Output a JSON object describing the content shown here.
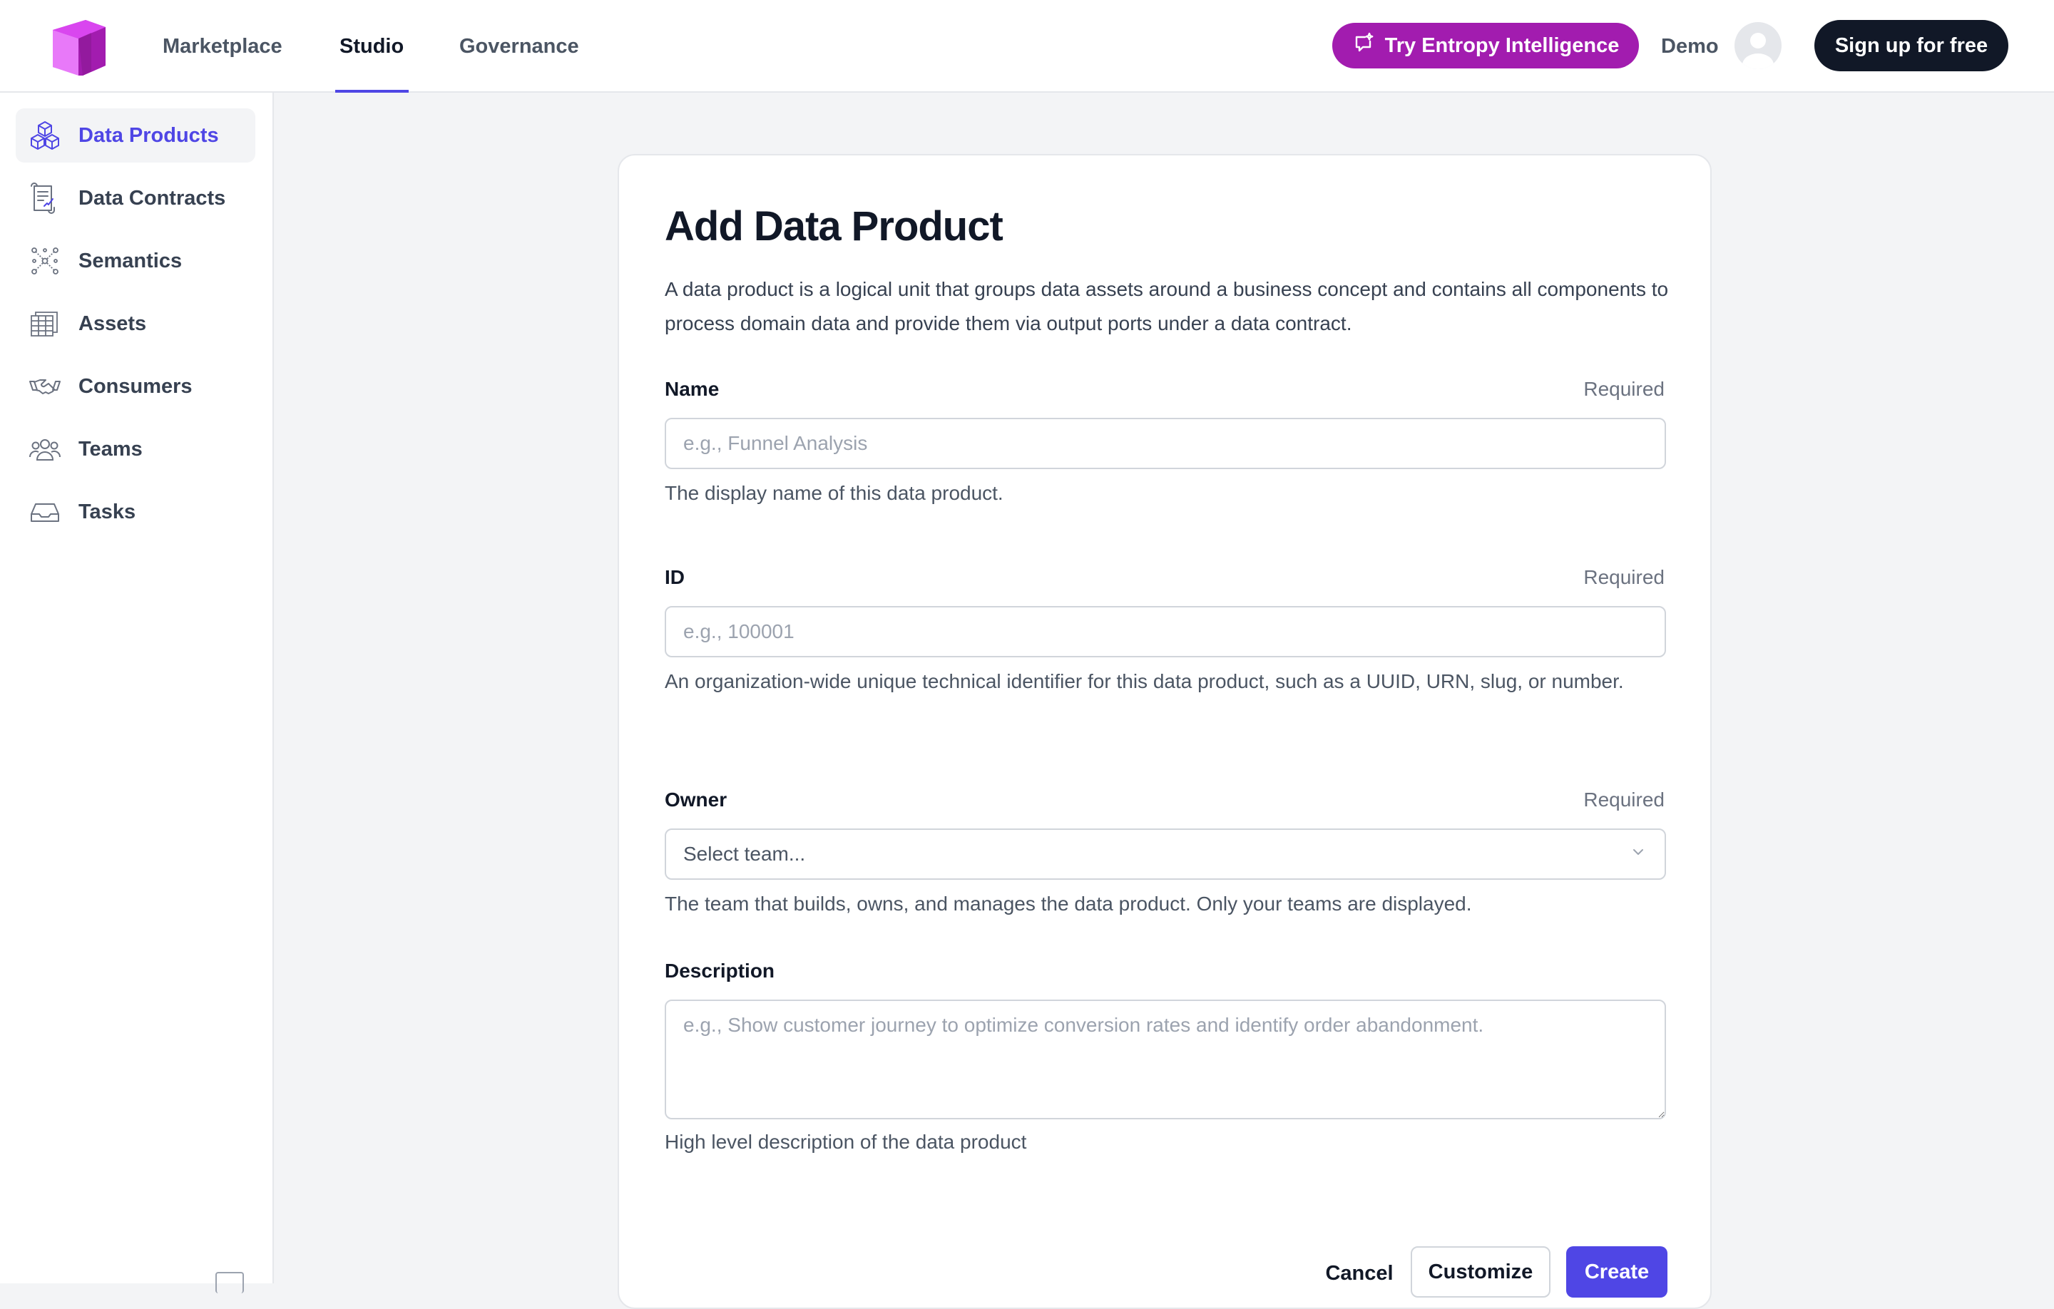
{
  "header": {
    "nav": [
      {
        "label": "Marketplace",
        "active": false
      },
      {
        "label": "Studio",
        "active": true
      },
      {
        "label": "Governance",
        "active": false
      }
    ],
    "ai_button_label": "Try Entropy Intelligence",
    "user_label": "Demo",
    "signup_label": "Sign up for free"
  },
  "sidebar": {
    "items": [
      {
        "label": "Data Products",
        "icon": "cubes-icon",
        "active": true
      },
      {
        "label": "Data Contracts",
        "icon": "contract-icon",
        "active": false
      },
      {
        "label": "Semantics",
        "icon": "graph-icon",
        "active": false
      },
      {
        "label": "Assets",
        "icon": "table-icon",
        "active": false
      },
      {
        "label": "Consumers",
        "icon": "handshake-icon",
        "active": false
      },
      {
        "label": "Teams",
        "icon": "users-icon",
        "active": false
      },
      {
        "label": "Tasks",
        "icon": "inbox-icon",
        "active": false
      }
    ]
  },
  "form": {
    "title": "Add Data Product",
    "description": "A data product is a logical unit that groups data assets around a business concept and contains all components to process domain data and provide them via output ports under a data contract.",
    "name": {
      "label": "Name",
      "required": "Required",
      "placeholder": "e.g., Funnel Analysis",
      "help": "The display name of this data product."
    },
    "id": {
      "label": "ID",
      "required": "Required",
      "placeholder": "e.g., 100001",
      "help": "An organization-wide unique technical identifier for this data product, such as a UUID, URN, slug, or number."
    },
    "owner": {
      "label": "Owner",
      "required": "Required",
      "selected": "Select team...",
      "help": "The team that builds, owns, and manages the data product. Only your teams are displayed."
    },
    "description_field": {
      "label": "Description",
      "placeholder": "e.g., Show customer journey to optimize conversion rates and identify order abandonment.",
      "help": "High level description of the data product"
    },
    "buttons": {
      "cancel": "Cancel",
      "customize": "Customize",
      "create": "Create"
    }
  },
  "colors": {
    "accent": "#4f46e5",
    "ai_button": "#a21caf",
    "dark_button": "#111827",
    "logo_pink": "#e879f9",
    "logo_purple": "#a21caf"
  }
}
